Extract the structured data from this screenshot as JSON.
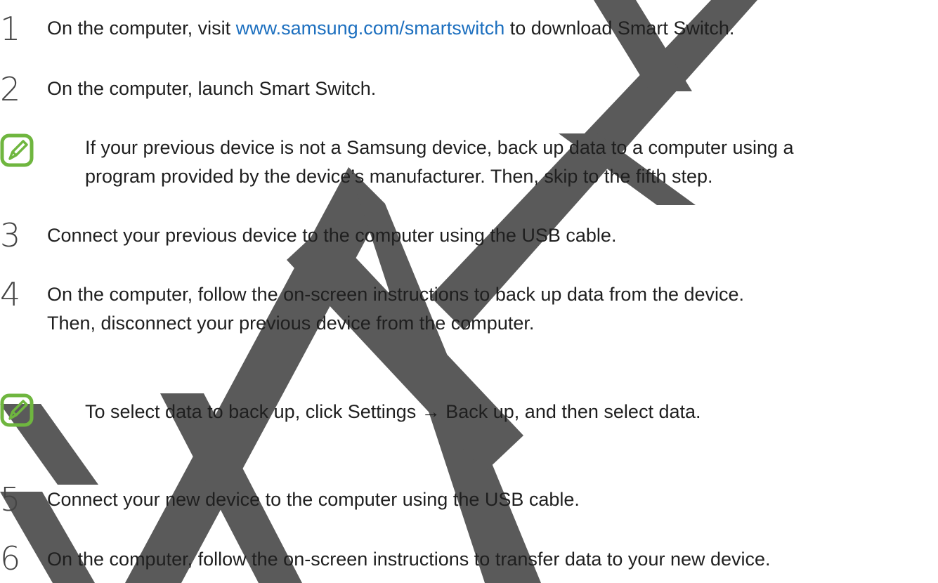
{
  "watermark": {
    "text": "DRAFT",
    "color": "#5a5a5a"
  },
  "steps": [
    {
      "number": "1",
      "text_before": "On the computer, visit ",
      "link": "www.samsung.com/smartswitch",
      "text_after": " to download Smart Switch."
    },
    {
      "number": "2",
      "text": "On the computer, launch Smart Switch."
    },
    {
      "number": "3",
      "text": "Connect your previous device to the computer using the USB cable."
    },
    {
      "number": "4",
      "line1": "On the computer, follow the on-screen instructions to back up data from the device.",
      "line2": "Then, disconnect your previous device from the computer."
    },
    {
      "number": "5",
      "text": "Connect your new device to the computer using the USB cable."
    },
    {
      "number": "6",
      "text": "On the computer, follow the on-screen instructions to transfer data to your new device."
    }
  ],
  "notes": [
    {
      "icon": "note-pencil-icon",
      "line1": "If your previous device is not a Samsung device, back up data to a computer using a",
      "line2": "program provided by the device’s manufacturer. Then, skip to the fifth step."
    },
    {
      "icon": "note-pencil-icon",
      "text": "To select data to back up, click Settings → Back up, and then select data."
    }
  ],
  "colors": {
    "link": "#1c6fbf",
    "note_icon": "#6fb63f",
    "text": "#1f1f1f"
  }
}
